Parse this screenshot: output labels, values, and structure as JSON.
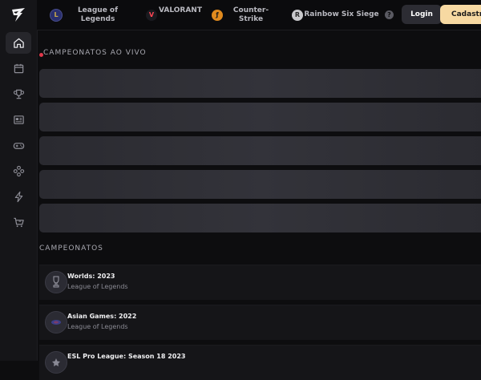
{
  "sidebar": {
    "items": [
      {
        "icon": "home-icon",
        "active": true
      },
      {
        "icon": "calendar-icon",
        "active": false
      },
      {
        "icon": "trophy-icon",
        "active": false
      },
      {
        "icon": "news-icon",
        "active": false
      },
      {
        "icon": "gamepad-icon",
        "active": false
      },
      {
        "icon": "puzzle-icon",
        "active": false
      },
      {
        "icon": "lightning-icon",
        "active": false
      },
      {
        "icon": "cart-icon",
        "active": false
      }
    ]
  },
  "topbar": {
    "games": [
      {
        "label": "League of Legends",
        "badge": "L",
        "badge_color": "#2a2f6e",
        "badge_text_color": "#c8a84a"
      },
      {
        "label": "VALORANT",
        "badge": "V",
        "badge_color": "#1a1a1f",
        "badge_text_color": "#ff4655"
      },
      {
        "label": "Counter-Strike",
        "badge": "ƒ",
        "badge_color": "#e08a1e",
        "badge_text_color": "#1a1a1a"
      },
      {
        "label": "Rainbow Six Siege",
        "badge": "R",
        "badge_color": "#c9c9cc",
        "badge_text_color": "#2a2a2a"
      }
    ],
    "help_label": "?",
    "login_label": "Login",
    "signup_label": "Cadastro"
  },
  "live": {
    "title": "CAMPEONATOS AO VIVO",
    "dot_color": "#e0384a"
  },
  "championships": {
    "title": "CAMPEONATOS",
    "items": [
      {
        "name": "Worlds: 2023",
        "game": "League of Legends"
      },
      {
        "name": "Asian Games: 2022",
        "game": "League of Legends"
      },
      {
        "name": "ESL Pro League: Season 18 2023",
        "game": ""
      }
    ]
  }
}
